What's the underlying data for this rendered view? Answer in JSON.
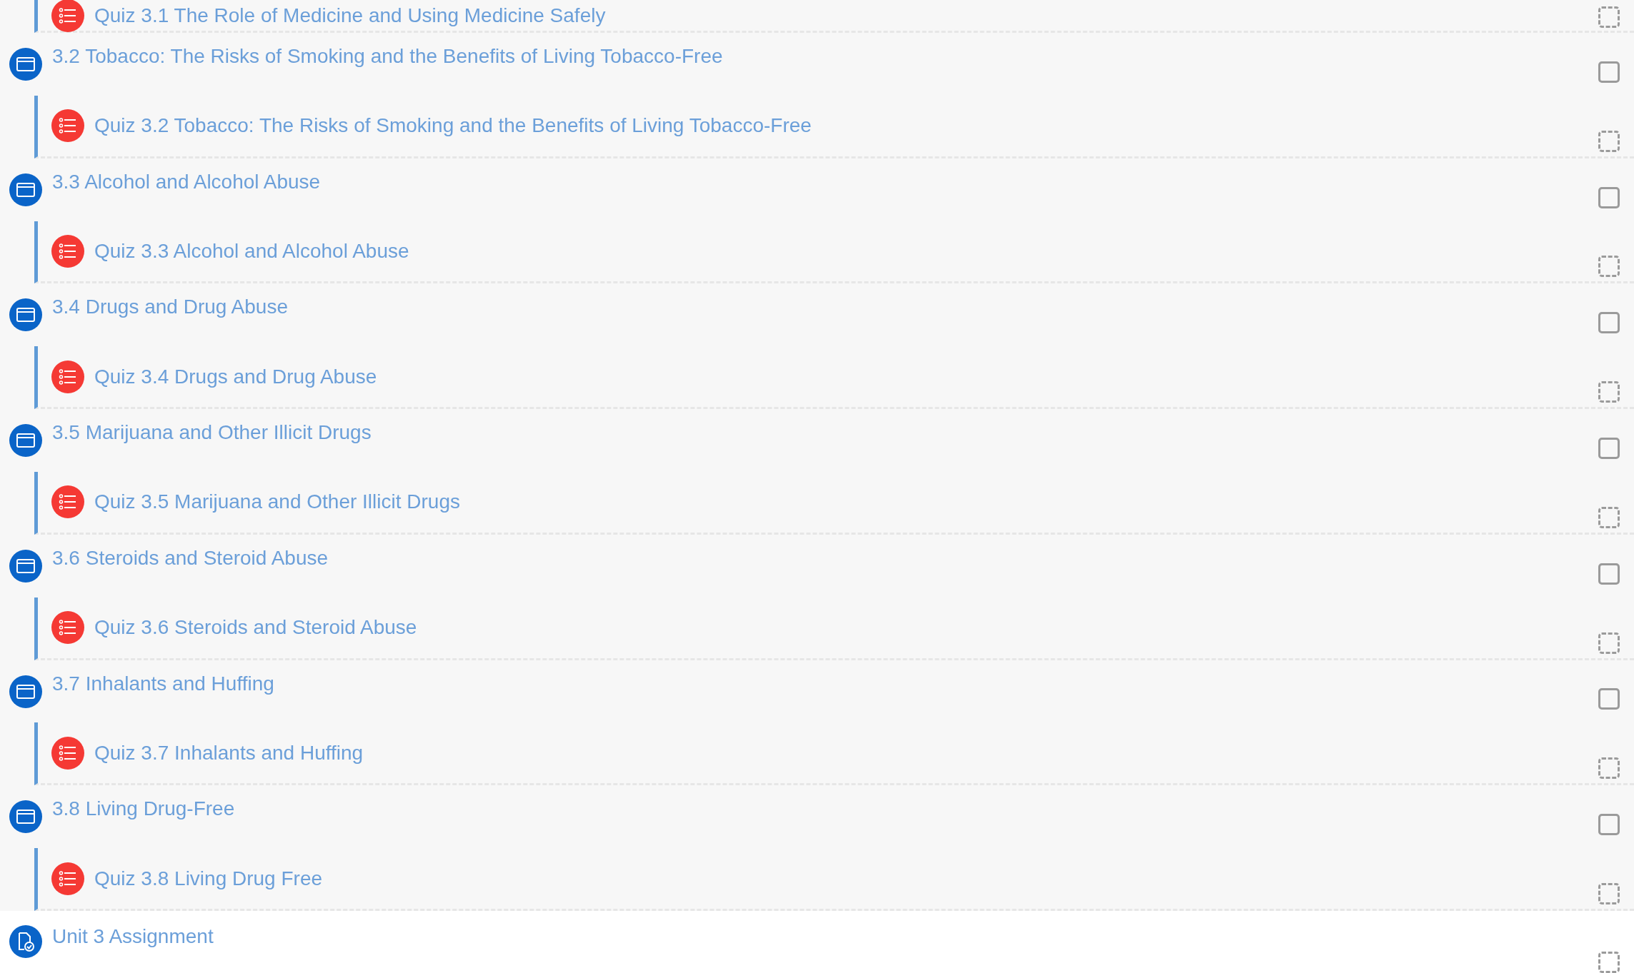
{
  "items": [
    {
      "kind": "quiz",
      "title": "Quiz 3.1 The Role of Medicine and Using Medicine Safely",
      "checked": false
    },
    {
      "kind": "lesson",
      "title": "3.2 Tobacco: The Risks of Smoking and the Benefits of Living Tobacco-Free",
      "checked": false
    },
    {
      "kind": "quiz",
      "title": "Quiz 3.2 Tobacco: The Risks of Smoking and the Benefits of Living Tobacco-Free",
      "checked": false
    },
    {
      "kind": "lesson",
      "title": "3.3 Alcohol and Alcohol Abuse",
      "checked": false
    },
    {
      "kind": "quiz",
      "title": "Quiz 3.3 Alcohol and Alcohol Abuse",
      "checked": false
    },
    {
      "kind": "lesson",
      "title": "3.4 Drugs and Drug Abuse",
      "checked": false
    },
    {
      "kind": "quiz",
      "title": "Quiz 3.4 Drugs and Drug Abuse",
      "checked": false
    },
    {
      "kind": "lesson",
      "title": "3.5 Marijuana and Other Illicit Drugs",
      "checked": false
    },
    {
      "kind": "quiz",
      "title": "Quiz 3.5 Marijuana and Other Illicit Drugs",
      "checked": false
    },
    {
      "kind": "lesson",
      "title": "3.6 Steroids and Steroid Abuse",
      "checked": false
    },
    {
      "kind": "quiz",
      "title": "Quiz 3.6 Steroids and Steroid Abuse",
      "checked": false
    },
    {
      "kind": "lesson",
      "title": "3.7 Inhalants and Huffing",
      "checked": false
    },
    {
      "kind": "quiz",
      "title": "Quiz 3.7 Inhalants and Huffing",
      "checked": false
    },
    {
      "kind": "lesson",
      "title": "3.8 Living Drug-Free",
      "checked": false
    },
    {
      "kind": "quiz",
      "title": "Quiz 3.8 Living Drug Free",
      "checked": false
    },
    {
      "kind": "assignment",
      "title": "Unit 3 Assignment",
      "checked": false
    }
  ]
}
